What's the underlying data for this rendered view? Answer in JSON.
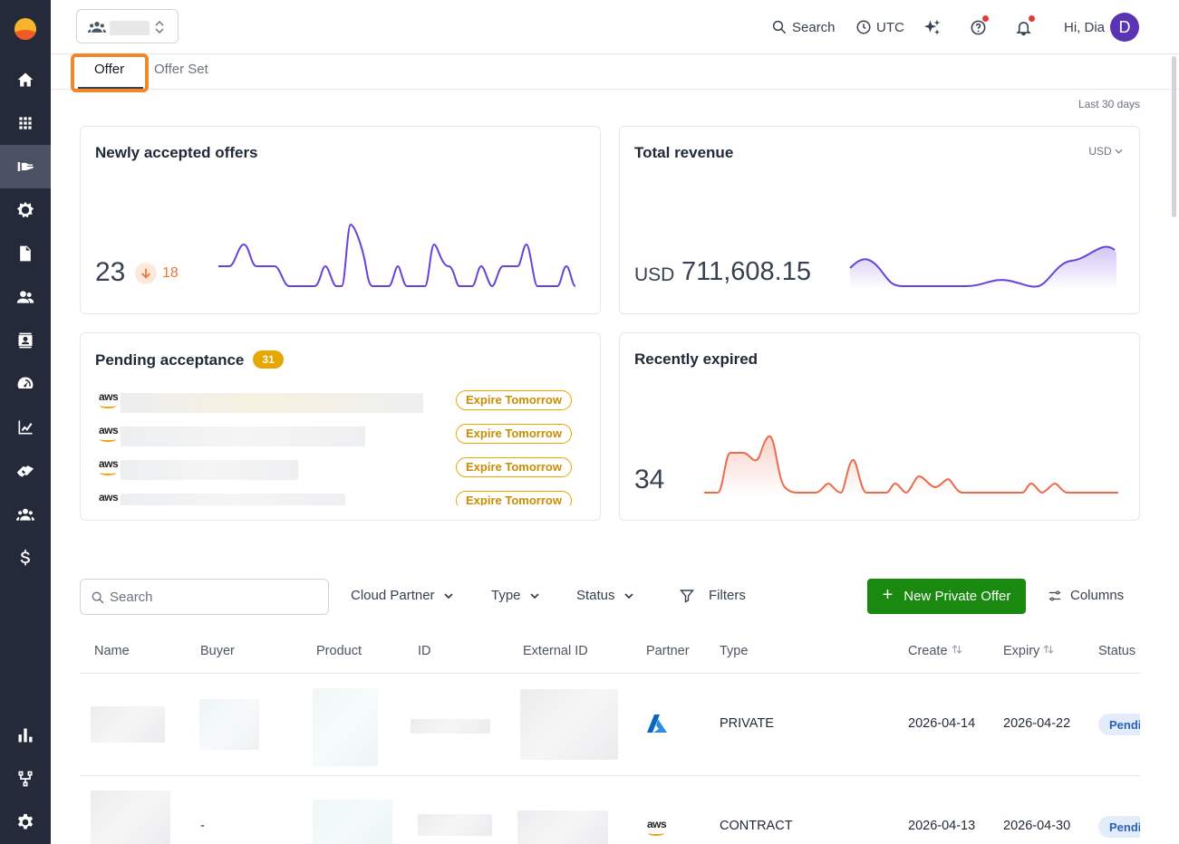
{
  "sidebar": {
    "items": [
      {
        "icon": "home-icon"
      },
      {
        "icon": "apps-grid-icon"
      },
      {
        "icon": "offer-hand-icon",
        "active": true
      },
      {
        "icon": "gear-sun-icon"
      },
      {
        "icon": "document-icon"
      },
      {
        "icon": "people-icon"
      },
      {
        "icon": "contact-card-icon"
      },
      {
        "icon": "speedometer-icon"
      },
      {
        "icon": "chart-trend-icon"
      },
      {
        "icon": "handshake-icon"
      },
      {
        "icon": "team-icon"
      },
      {
        "icon": "dollar-icon"
      }
    ],
    "bottom_items": [
      {
        "icon": "bar-chart-icon"
      },
      {
        "icon": "workflow-icon"
      },
      {
        "icon": "settings-icon"
      }
    ]
  },
  "header": {
    "search_label": "Search",
    "timezone_label": "UTC",
    "greeting": "Hi, Dia",
    "avatar_initial": "D"
  },
  "tabs": [
    {
      "label": "Offer",
      "active": true
    },
    {
      "label": "Offer Set",
      "active": false
    }
  ],
  "date_range": "Last 30 days",
  "cards": {
    "newly_accepted": {
      "title": "Newly accepted offers",
      "value": "23",
      "delta": "18",
      "delta_direction": "down",
      "delta_color": "#e8773a"
    },
    "total_revenue": {
      "title": "Total revenue",
      "currency_selector": "USD",
      "currency_label": "USD",
      "value": "711,608.15"
    },
    "pending": {
      "title": "Pending acceptance",
      "count": "31",
      "rows": [
        {
          "partner_logo": "aws",
          "tag": "Expire Tomorrow"
        },
        {
          "partner_logo": "aws",
          "tag": "Expire Tomorrow"
        },
        {
          "partner_logo": "aws",
          "tag": "Expire Tomorrow"
        },
        {
          "partner_logo": "aws",
          "tag": "Expire Tomorrow"
        }
      ]
    },
    "recently_expired": {
      "title": "Recently expired",
      "value": "34"
    }
  },
  "toolbar": {
    "search_placeholder": "Search",
    "filter_cloud_partner": "Cloud Partner",
    "filter_type": "Type",
    "filter_status": "Status",
    "filters_label": "Filters",
    "new_offer_label": "New Private Offer",
    "columns_label": "Columns",
    "new_offer_color": "#198a0f"
  },
  "table": {
    "columns": [
      "Name",
      "Buyer",
      "Product",
      "ID",
      "External ID",
      "Partner",
      "Type",
      "Create",
      "Expiry",
      "Status"
    ],
    "rows": [
      {
        "buyer": "",
        "partner_icon": "azure-icon",
        "partner_logo_text": "",
        "type": "PRIVATE",
        "create": "2026-04-14",
        "expiry": "2026-04-22",
        "status": "Pending"
      },
      {
        "buyer": "-",
        "partner_icon": "aws-icon",
        "partner_logo_text": "aws",
        "type": "CONTRACT",
        "create": "2026-04-13",
        "expiry": "2026-04-30",
        "status": "Pending"
      }
    ]
  }
}
